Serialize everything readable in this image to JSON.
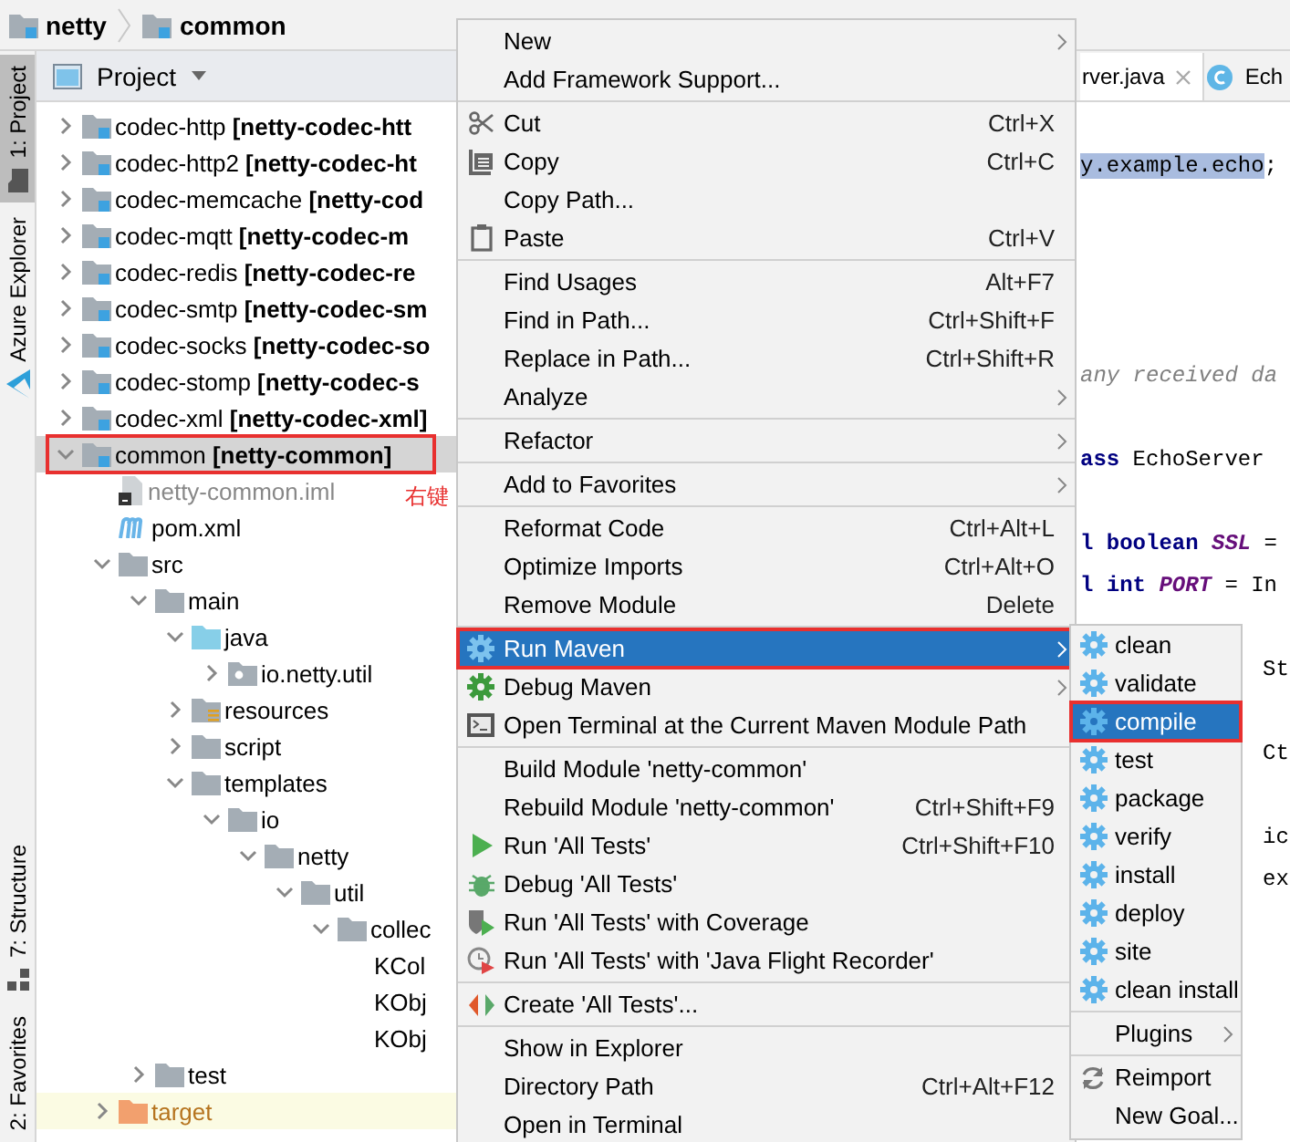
{
  "breadcrumb": [
    {
      "label": "netty"
    },
    {
      "label": "common"
    }
  ],
  "tool_strip": {
    "top": [
      {
        "label": "1: Project",
        "selected": true
      },
      {
        "label": "Azure Explorer",
        "selected": false
      }
    ],
    "bottom": [
      {
        "label": "7: Structure",
        "selected": false
      },
      {
        "label": "2: Favorites",
        "selected": false
      }
    ]
  },
  "project": {
    "title": "Project",
    "tree": [
      {
        "label": "codec-http **[netty-codec-htt**",
        "kind": "module",
        "expanded": false,
        "selected": false
      },
      {
        "label": "codec-http2 **[netty-codec-ht**",
        "kind": "module",
        "expanded": false,
        "selected": false
      },
      {
        "label": "codec-memcache **[netty-cod**",
        "kind": "module",
        "expanded": false,
        "selected": false
      },
      {
        "label": "codec-mqtt **[netty-codec-m**",
        "kind": "module",
        "expanded": false,
        "selected": false
      },
      {
        "label": "codec-redis **[netty-codec-re**",
        "kind": "module",
        "expanded": false,
        "selected": false
      },
      {
        "label": "codec-smtp **[netty-codec-sm**",
        "kind": "module",
        "expanded": false,
        "selected": false
      },
      {
        "label": "codec-socks **[netty-codec-so**",
        "kind": "module",
        "expanded": false,
        "selected": false
      },
      {
        "label": "codec-stomp **[netty-codec-s**",
        "kind": "module",
        "expanded": false,
        "selected": false
      },
      {
        "label": "codec-xml **[netty-codec-xml]**",
        "kind": "module",
        "expanded": false,
        "selected": false
      },
      {
        "label": "common **[netty-common]**",
        "kind": "module",
        "expanded": true,
        "selected": true,
        "annotated": true,
        "children": [
          {
            "label": "netty-common.iml",
            "kind": "iml",
            "selected": false,
            "note": "右键"
          },
          {
            "label": "pom.xml",
            "kind": "maven",
            "selected": false
          },
          {
            "label": "src",
            "kind": "folder",
            "expanded": true,
            "selected": false,
            "children": [
              {
                "label": "main",
                "kind": "folder",
                "expanded": true,
                "selected": false,
                "children": [
                  {
                    "label": "java",
                    "kind": "source",
                    "expanded": true,
                    "selected": false,
                    "children": [
                      {
                        "label": "io.netty.util",
                        "kind": "package",
                        "expanded": false,
                        "selected": false
                      }
                    ]
                  },
                  {
                    "label": "resources",
                    "kind": "resources",
                    "expanded": false,
                    "selected": false
                  },
                  {
                    "label": "script",
                    "kind": "folder",
                    "expanded": false,
                    "selected": false
                  },
                  {
                    "label": "templates",
                    "kind": "folder",
                    "expanded": true,
                    "selected": false,
                    "children": [
                      {
                        "label": "io",
                        "kind": "folder",
                        "expanded": true,
                        "selected": false,
                        "children": [
                          {
                            "label": "netty",
                            "kind": "folder",
                            "expanded": true,
                            "selected": false,
                            "children": [
                              {
                                "label": "util",
                                "kind": "folder",
                                "expanded": true,
                                "selected": false,
                                "children": [
                                  {
                                    "label": "collec",
                                    "kind": "folder",
                                    "expanded": true,
                                    "selected": false,
                                    "children": [
                                      {
                                        "label": "KCol",
                                        "selected": false
                                      },
                                      {
                                        "label": "KObj",
                                        "selected": false
                                      },
                                      {
                                        "label": "KObj",
                                        "selected": false
                                      }
                                    ]
                                  }
                                ]
                              }
                            ]
                          }
                        ]
                      }
                    ]
                  }
                ]
              },
              {
                "label": "test",
                "kind": "folder",
                "expanded": false,
                "selected": false
              }
            ]
          },
          {
            "label": "target",
            "kind": "excluded",
            "expanded": false,
            "selected": false
          }
        ]
      }
    ]
  },
  "editor": {
    "tabs": [
      {
        "label": "rver.java",
        "selected": true
      },
      {
        "label": "Ech",
        "selected": false
      }
    ],
    "lines": [
      {
        "kind": "code",
        "tokens": [
          {
            "text": "y.example.echo",
            "kind": "selection"
          },
          {
            "text": ";",
            "kind": "plain"
          }
        ]
      },
      {
        "kind": "blank"
      },
      {
        "kind": "blank"
      },
      {
        "kind": "blank"
      },
      {
        "kind": "blank"
      },
      {
        "kind": "code",
        "tokens": [
          {
            "text": "any received da",
            "kind": "comment"
          }
        ]
      },
      {
        "kind": "blank"
      },
      {
        "kind": "code",
        "tokens": [
          {
            "text": "ass",
            "kind": "keyword"
          },
          {
            "text": "EchoServer",
            "kind": "plain"
          }
        ]
      },
      {
        "kind": "blank"
      },
      {
        "kind": "code",
        "tokens": [
          {
            "text": "l boolean",
            "kind": "keyword"
          },
          {
            "text": "SSL",
            "kind": "field"
          },
          {
            "text": "=",
            "kind": "plain"
          }
        ]
      },
      {
        "kind": "code",
        "tokens": [
          {
            "text": "l int",
            "kind": "keyword"
          },
          {
            "text": "PORT",
            "kind": "field"
          },
          {
            "text": "= In",
            "kind": "plain"
          }
        ]
      },
      {
        "kind": "blank"
      },
      {
        "kind": "edge",
        "tokens": [
          {
            "text": "St",
            "kind": "plain"
          }
        ]
      },
      {
        "kind": "blank"
      },
      {
        "kind": "edge",
        "tokens": [
          {
            "text": "Ct",
            "kind": "plain"
          }
        ]
      },
      {
        "kind": "blank"
      },
      {
        "kind": "edge",
        "tokens": [
          {
            "text": "ic",
            "kind": "plain"
          }
        ]
      },
      {
        "kind": "edge",
        "tokens": [
          {
            "text": "ex",
            "kind": "plain"
          }
        ]
      }
    ]
  },
  "context_menu": [
    {
      "kind": "item",
      "label": "New",
      "submenu": true
    },
    {
      "kind": "item",
      "label": "Add Framework Support..."
    },
    {
      "kind": "separator"
    },
    {
      "kind": "item",
      "label": "Cut",
      "shortcut": "Ctrl+X"
    },
    {
      "kind": "item",
      "label": "Copy",
      "shortcut": "Ctrl+C"
    },
    {
      "kind": "item",
      "label": "Copy Path..."
    },
    {
      "kind": "item",
      "label": "Paste",
      "shortcut": "Ctrl+V"
    },
    {
      "kind": "separator"
    },
    {
      "kind": "item",
      "label": "Find Usages",
      "shortcut": "Alt+F7"
    },
    {
      "kind": "item",
      "label": "Find in Path...",
      "shortcut": "Ctrl+Shift+F"
    },
    {
      "kind": "item",
      "label": "Replace in Path...",
      "shortcut": "Ctrl+Shift+R"
    },
    {
      "kind": "item",
      "label": "Analyze",
      "submenu": true
    },
    {
      "kind": "separator"
    },
    {
      "kind": "item",
      "label": "Refactor",
      "submenu": true
    },
    {
      "kind": "separator"
    },
    {
      "kind": "item",
      "label": "Add to Favorites",
      "submenu": true
    },
    {
      "kind": "separator"
    },
    {
      "kind": "item",
      "label": "Reformat Code",
      "shortcut": "Ctrl+Alt+L"
    },
    {
      "kind": "item",
      "label": "Optimize Imports",
      "shortcut": "Ctrl+Alt+O"
    },
    {
      "kind": "item",
      "label": "Remove Module",
      "shortcut": "Delete"
    },
    {
      "kind": "separator"
    },
    {
      "kind": "item",
      "label": "Run Maven",
      "submenu": true,
      "selected": true,
      "annotated": true
    },
    {
      "kind": "item",
      "label": "Debug Maven",
      "submenu": true
    },
    {
      "kind": "item",
      "label": "Open Terminal at the Current Maven Module Path"
    },
    {
      "kind": "separator"
    },
    {
      "kind": "item",
      "label": "Build Module 'netty-common'"
    },
    {
      "kind": "item",
      "label": "Rebuild Module 'netty-common'",
      "shortcut": "Ctrl+Shift+F9"
    },
    {
      "kind": "item",
      "label": "Run 'All Tests'",
      "shortcut": "Ctrl+Shift+F10"
    },
    {
      "kind": "item",
      "label": "Debug 'All Tests'"
    },
    {
      "kind": "item",
      "label": "Run 'All Tests' with Coverage"
    },
    {
      "kind": "item",
      "label": "Run 'All Tests' with 'Java Flight Recorder'"
    },
    {
      "kind": "separator"
    },
    {
      "kind": "item",
      "label": "Create 'All Tests'..."
    },
    {
      "kind": "separator"
    },
    {
      "kind": "item",
      "label": "Show in Explorer"
    },
    {
      "kind": "item",
      "label": "Directory Path",
      "shortcut": "Ctrl+Alt+F12"
    },
    {
      "kind": "item",
      "label": "Open in Terminal"
    }
  ],
  "maven_submenu": [
    {
      "kind": "goal",
      "label": "clean",
      "selected": false
    },
    {
      "kind": "goal",
      "label": "validate",
      "selected": false
    },
    {
      "kind": "goal",
      "label": "compile",
      "selected": true,
      "annotated": true
    },
    {
      "kind": "goal",
      "label": "test",
      "selected": false
    },
    {
      "kind": "goal",
      "label": "package",
      "selected": false
    },
    {
      "kind": "goal",
      "label": "verify",
      "selected": false
    },
    {
      "kind": "goal",
      "label": "install",
      "selected": false
    },
    {
      "kind": "goal",
      "label": "deploy",
      "selected": false
    },
    {
      "kind": "goal",
      "label": "site",
      "selected": false
    },
    {
      "kind": "goal",
      "label": "clean install",
      "selected": false
    },
    {
      "kind": "separator"
    },
    {
      "kind": "plugins",
      "label": "Plugins",
      "submenu": true,
      "selected": false
    },
    {
      "kind": "separator"
    },
    {
      "kind": "reimport",
      "label": "Reimport",
      "selected": false
    },
    {
      "kind": "plain",
      "label": "New Goal...",
      "selected": false
    }
  ]
}
